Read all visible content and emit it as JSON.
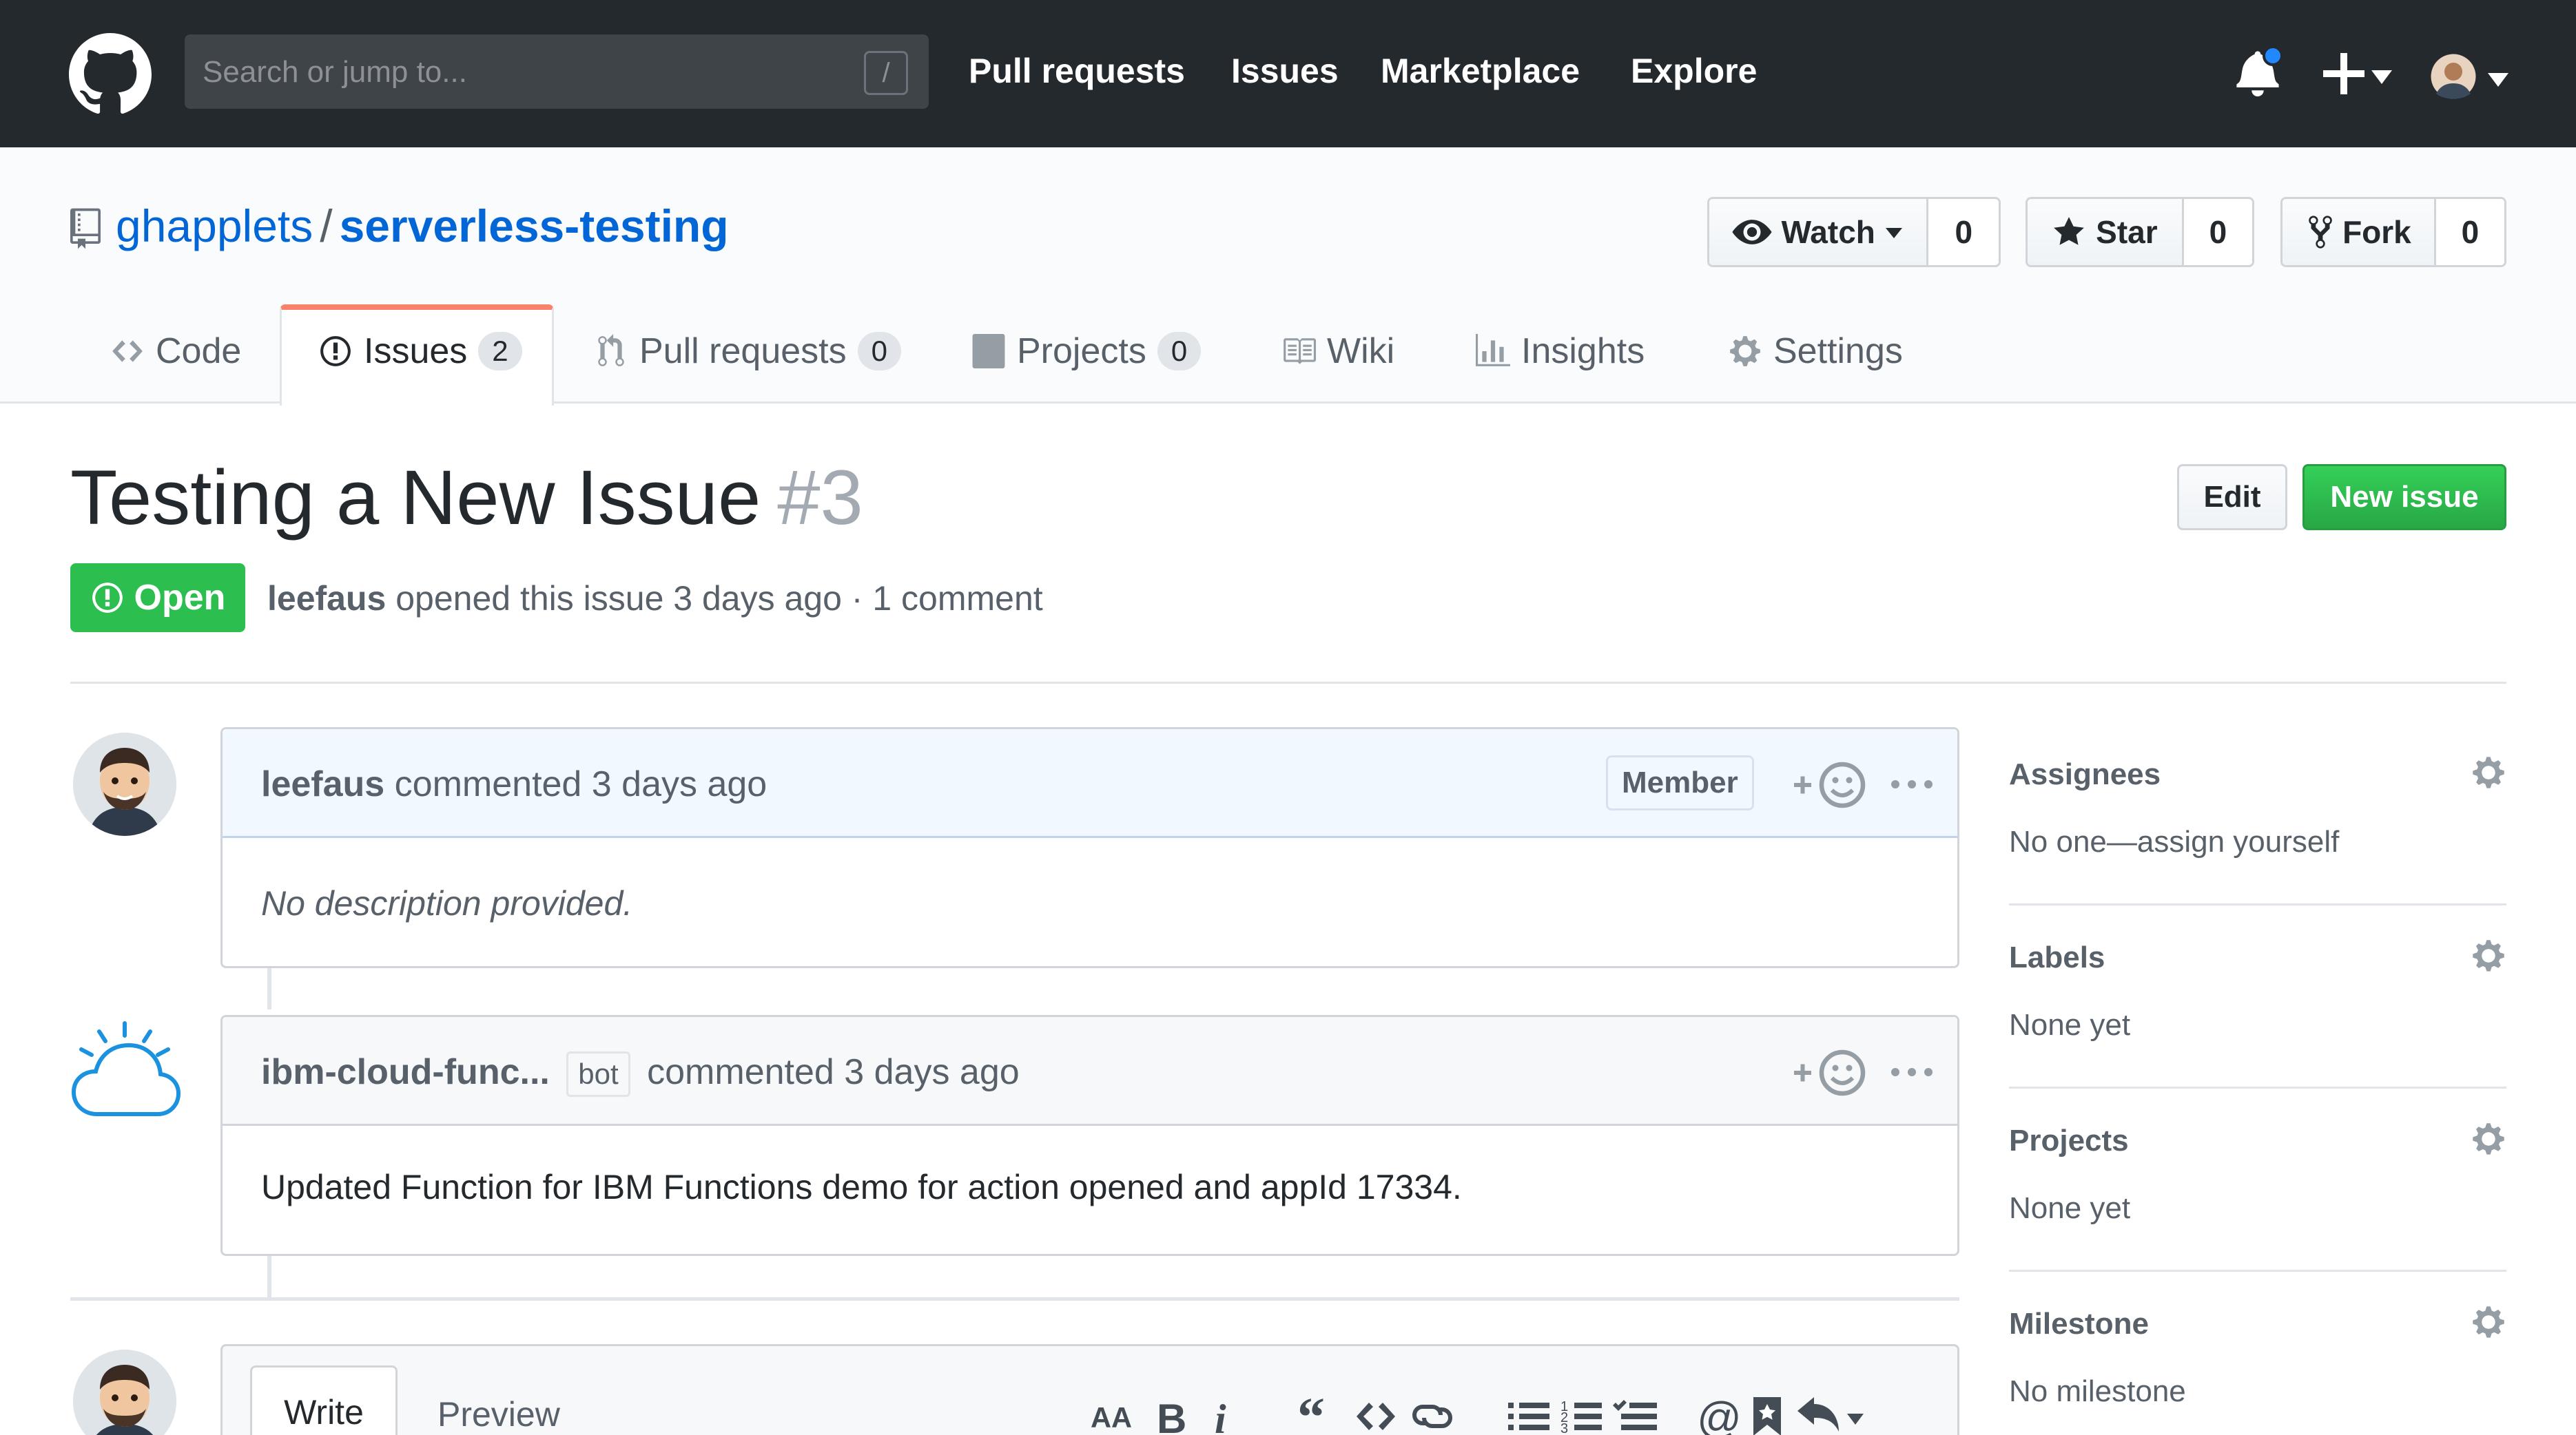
{
  "header": {
    "search_placeholder": "Search or jump to...",
    "search_shortcut": "/",
    "nav": [
      "Pull requests",
      "Issues",
      "Marketplace",
      "Explore"
    ]
  },
  "repo": {
    "owner": "ghapplets",
    "separator": "/",
    "name": "serverless-testing",
    "watch_label": "Watch",
    "watch_count": "0",
    "star_label": "Star",
    "star_count": "0",
    "fork_label": "Fork",
    "fork_count": "0"
  },
  "tabs": [
    {
      "label": "Code",
      "icon": "code-icon"
    },
    {
      "label": "Issues",
      "count": "2",
      "icon": "issue-icon"
    },
    {
      "label": "Pull requests",
      "count": "0",
      "icon": "pull-request-icon"
    },
    {
      "label": "Projects",
      "count": "0",
      "icon": "project-icon"
    },
    {
      "label": "Wiki",
      "icon": "book-icon"
    },
    {
      "label": "Insights",
      "icon": "graph-icon"
    },
    {
      "label": "Settings",
      "icon": "gear-icon"
    }
  ],
  "issue": {
    "title": "Testing a New Issue",
    "number": "#3",
    "state": "Open",
    "edit_label": "Edit",
    "new_issue_label": "New issue",
    "author": "leefaus",
    "meta_text": "opened this issue 3 days ago · 1 comment"
  },
  "comments": [
    {
      "author": "leefaus",
      "action": "commented 3 days ago",
      "label": "Member",
      "body": "No description provided."
    },
    {
      "author": "ibm-cloud-func...",
      "bot_label": "bot",
      "action": "commented 3 days ago",
      "body": "Updated Function for IBM Functions demo for action opened and appId 17334."
    }
  ],
  "editor": {
    "write_tab": "Write",
    "preview_tab": "Preview"
  },
  "sidebar": {
    "assignees": {
      "heading": "Assignees",
      "value": "No one—assign yourself"
    },
    "labels": {
      "heading": "Labels",
      "value": "None yet"
    },
    "projects": {
      "heading": "Projects",
      "value": "None yet"
    },
    "milestone": {
      "heading": "Milestone",
      "value": "No milestone"
    }
  },
  "colors": {
    "header_bg": "#24292e",
    "link": "#0366d6",
    "open_green": "#2cbe4e",
    "tab_accent": "#f9826c"
  }
}
